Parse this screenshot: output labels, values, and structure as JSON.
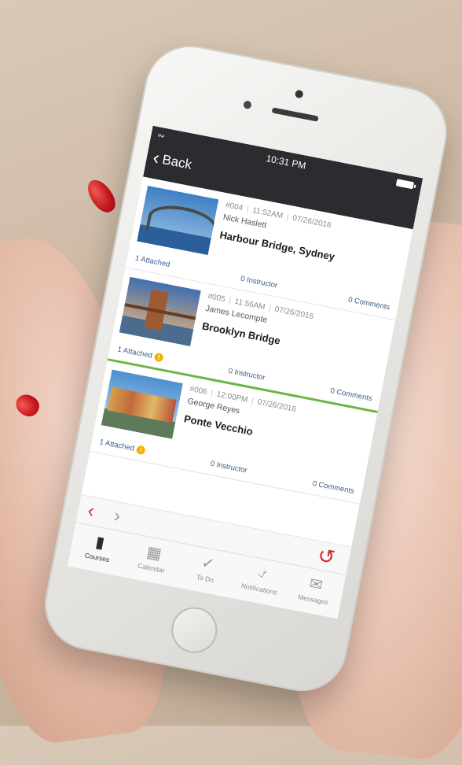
{
  "status": {
    "time": "10:31 PM"
  },
  "header": {
    "back_label": "Back"
  },
  "cards": [
    {
      "id": "#004",
      "time": "11:52AM",
      "date": "07/26/2016",
      "author": "Nick Haslett",
      "title": "Harbour Bridge, Sydney",
      "attached": "1 Attached",
      "has_badge": false,
      "instructor": "0 Instructor",
      "comments": "0 Comments"
    },
    {
      "id": "#005",
      "time": "11:56AM",
      "date": "07/26/2016",
      "author": "James Lecompte",
      "title": "Brooklyn Bridge",
      "attached": "1 Attached",
      "has_badge": true,
      "instructor": "0 Instructor",
      "comments": "0 Comments"
    },
    {
      "id": "#006",
      "time": "12:00PM",
      "date": "07/26/2016",
      "author": "George Reyes",
      "title": "Ponte Vecchio",
      "attached": "1 Attached",
      "has_badge": true,
      "instructor": "0 Instructor",
      "comments": "0 Comments"
    }
  ],
  "badge_symbol": "!",
  "tabs": [
    {
      "label": "Courses",
      "icon": "book-icon",
      "active": true
    },
    {
      "label": "Calendar",
      "icon": "calendar-icon",
      "active": false
    },
    {
      "label": "To Do",
      "icon": "checkmark-icon",
      "active": false
    },
    {
      "label": "Notifications",
      "icon": "bell-icon",
      "active": false
    },
    {
      "label": "Messages",
      "icon": "envelope-icon",
      "active": false
    }
  ],
  "colors": {
    "accent_red": "#d22b2b",
    "highlight_green": "#6bb440",
    "statusbar": "#2b2c30",
    "badge": "#f0b400"
  }
}
